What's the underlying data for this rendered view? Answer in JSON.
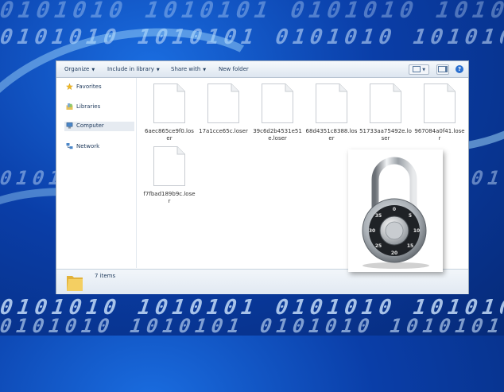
{
  "toolbar": {
    "organize": "Organize",
    "include_in_library": "Include in library",
    "share_with": "Share with",
    "new_folder": "New folder",
    "help": "?"
  },
  "nav": {
    "favorites": "Favorites",
    "libraries": "Libraries",
    "computer": "Computer",
    "network": "Network"
  },
  "files": [
    {
      "name": "6aec865ce9f0.loser"
    },
    {
      "name": "17a1cce65c.loser"
    },
    {
      "name": "39c6d2b4531e51e.loser"
    },
    {
      "name": "68d4351c8388.loser"
    },
    {
      "name": "51733aa75492e.loser"
    },
    {
      "name": "967084a0f41.loser"
    },
    {
      "name": "f7fbad189b9c.loser"
    }
  ],
  "status": {
    "item_count": "7 items"
  },
  "background": {
    "digits": "0101010 1010101 0101010 1010101 0101010 1010101"
  },
  "padlock": {
    "dial_numbers": [
      "0",
      "5",
      "10",
      "15",
      "20",
      "25",
      "30",
      "35"
    ]
  },
  "colors": {
    "background_blue": "#0a3ea8",
    "toolbar_text": "#1e395b",
    "selected_nav": "#e6ebf1"
  }
}
